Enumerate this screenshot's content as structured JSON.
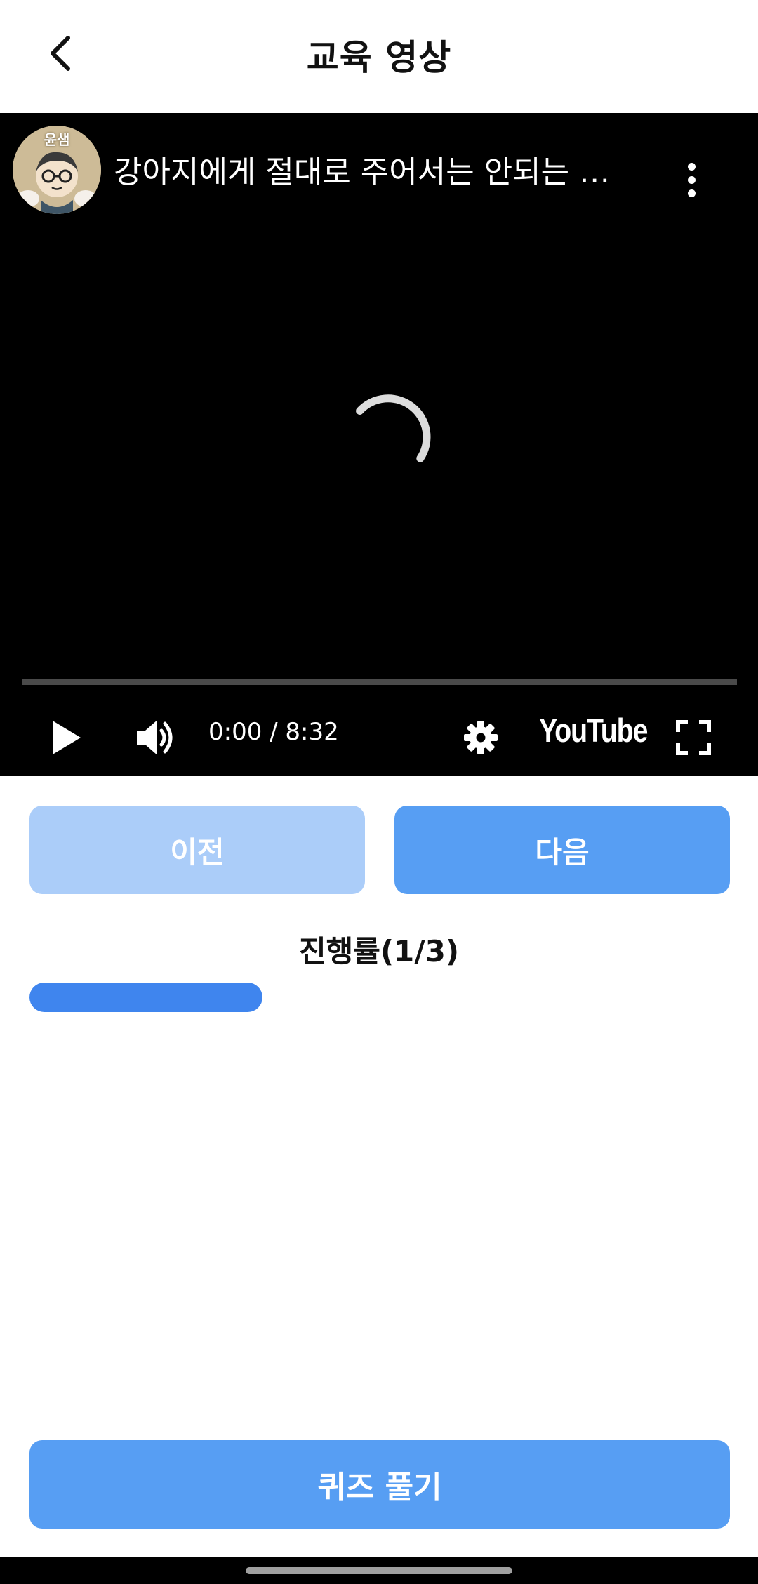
{
  "header": {
    "title": "교육 영상",
    "back_icon": "chevron-left-icon"
  },
  "player": {
    "channel_avatar_text": "윤샘",
    "video_title": "강아지에게 절대로 주어서는 안되는 음...",
    "time_display": "0:00 / 8:32",
    "brand_logo": "YouTube",
    "playback_progress": 0
  },
  "nav": {
    "prev_label": "이전",
    "next_label": "다음"
  },
  "progress": {
    "label": "진행률(1/3)",
    "current": 1,
    "total": 3
  },
  "quiz": {
    "button_label": "퀴즈 풀기"
  },
  "colors": {
    "primary": "#579ef3",
    "primary_disabled": "#abcdf9",
    "progress_fill": "#3f85ee"
  }
}
